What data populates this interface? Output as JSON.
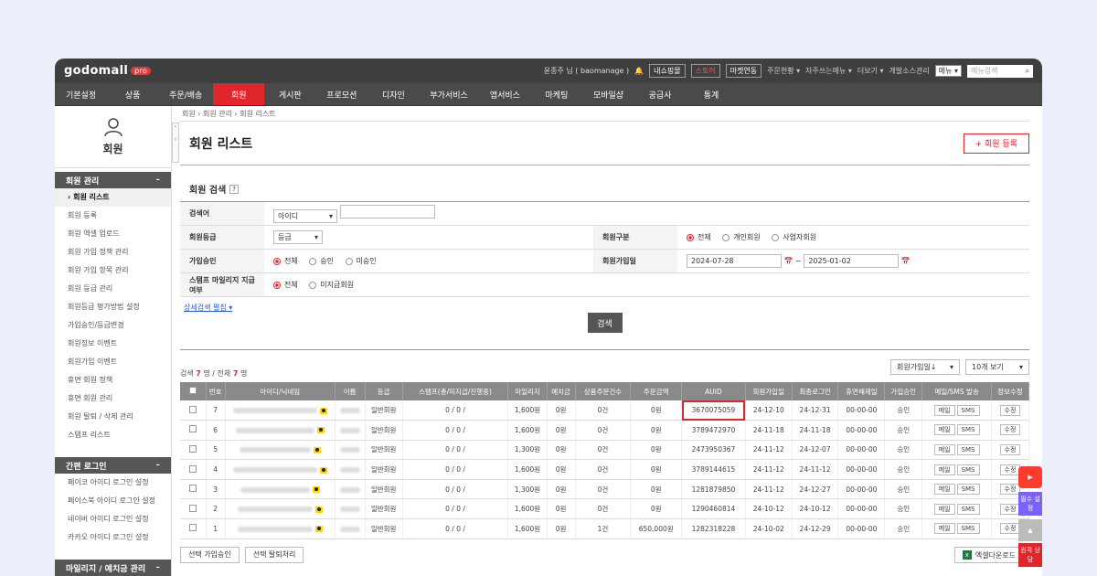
{
  "brand": {
    "logo": "godomall",
    "badge": "pro"
  },
  "topbar": {
    "user": "윤종주 님 ( baomanage )",
    "buttons": [
      "내쇼핑몰",
      "스토어",
      "마켓연동"
    ],
    "links": [
      "주문현황",
      "자주쓰는메뉴",
      "더보기",
      "개발소스관리"
    ],
    "menu_select": "메뉴",
    "search_placeholder": "메뉴검색"
  },
  "nav": [
    "기본설정",
    "상품",
    "주문/배송",
    "회원",
    "게시판",
    "프로모션",
    "디자인",
    "부가서비스",
    "앱서비스",
    "마케팅",
    "모바일샵",
    "공급사",
    "통계"
  ],
  "sidebar": {
    "title": "회원",
    "sections": [
      {
        "label": "회원 관리",
        "items": [
          "› 회원 리스트",
          "회원 등록",
          "회원 엑셀 업로드",
          "회원 가입 정책 관리",
          "회원 가입 항목 관리",
          "회원 등급 관리",
          "회원등급 평가방법 설정",
          "가입승인/등급변경",
          "회원정보 이벤트",
          "회원가입 이벤트",
          "휴면 회원 정책",
          "휴면 회원 관리",
          "회원 탈퇴 / 삭제 관리",
          "스탬프 리스트"
        ]
      },
      {
        "label": "간편 로그인",
        "items": [
          "페이코 아이디 로그인 설정",
          "페이스북 아이디 로그인 설정",
          "네이버 아이디 로그인 설정",
          "카카오 아이디 로그인 설정"
        ]
      },
      {
        "label": "마일리지 / 예치금 관리",
        "items": []
      }
    ]
  },
  "breadcrumb": "회원 › 회원 관리 › 회원 리스트",
  "page": {
    "title": "회원 리스트",
    "register_btn": "+ 회원 등록"
  },
  "search": {
    "title": "회원 검색",
    "help": "?",
    "keyword_label": "검색어",
    "keyword_select": "아이디",
    "grade_label": "회원등급",
    "grade_select": "등급",
    "type_label": "회원구분",
    "type_options": [
      "전체",
      "개인회원",
      "사업자회원"
    ],
    "approve_label": "가입승인",
    "approve_options": [
      "전체",
      "승인",
      "미승인"
    ],
    "joindate_label": "회원가입일",
    "date_from": "2024-07-28",
    "date_to": "2025-01-02",
    "stamp_label": "스탬프 마일리지 지급여부",
    "stamp_options": [
      "전체",
      "미지급회원"
    ],
    "detail_link": "상세검색 펼침",
    "search_btn": "검색"
  },
  "list": {
    "count_prefix": "검색",
    "count": "7",
    "count_mid": "명 / 전체",
    "total": "7",
    "count_suffix": "명",
    "sort": "회원가입일↓",
    "page_size": "10개 보기",
    "headers": [
      "",
      "번호",
      "아이디/닉네임",
      "이름",
      "등급",
      "스탬프(총/미지급/진행중)",
      "마일리지",
      "예치금",
      "상품주문건수",
      "주문금액",
      "AUID",
      "회원가입일",
      "최종로그인",
      "휴면해제일",
      "가입승인",
      "메일/SMS 발송",
      "정보수정"
    ],
    "rows": [
      {
        "no": "7",
        "grade": "일반회원",
        "stamp": "0 / 0 /",
        "mileage": "1,600원",
        "deposit": "0원",
        "orders": "0건",
        "amount": "0원",
        "auid": "3670075059",
        "join": "24-12-10",
        "login": "24-12-31",
        "dormant": "00-00-00",
        "approve": "승인"
      },
      {
        "no": "6",
        "grade": "일반회원",
        "stamp": "0 / 0 /",
        "mileage": "1,600원",
        "deposit": "0원",
        "orders": "0건",
        "amount": "0원",
        "auid": "3789472970",
        "join": "24-11-18",
        "login": "24-11-18",
        "dormant": "00-00-00",
        "approve": "승인"
      },
      {
        "no": "5",
        "grade": "일반회원",
        "stamp": "0 / 0 /",
        "mileage": "1,300원",
        "deposit": "0원",
        "orders": "0건",
        "amount": "0원",
        "auid": "2473950367",
        "join": "24-11-12",
        "login": "24-12-07",
        "dormant": "00-00-00",
        "approve": "승인"
      },
      {
        "no": "4",
        "grade": "일반회원",
        "stamp": "0 / 0 /",
        "mileage": "1,600원",
        "deposit": "0원",
        "orders": "0건",
        "amount": "0원",
        "auid": "3789144615",
        "join": "24-11-12",
        "login": "24-11-12",
        "dormant": "00-00-00",
        "approve": "승인"
      },
      {
        "no": "3",
        "grade": "일반회원",
        "stamp": "0 / 0 /",
        "mileage": "1,300원",
        "deposit": "0원",
        "orders": "0건",
        "amount": "0원",
        "auid": "1281879850",
        "join": "24-11-12",
        "login": "24-12-27",
        "dormant": "00-00-00",
        "approve": "승인"
      },
      {
        "no": "2",
        "grade": "일반회원",
        "stamp": "0 / 0 /",
        "mileage": "1,600원",
        "deposit": "0원",
        "orders": "0건",
        "amount": "0원",
        "auid": "1290460814",
        "join": "24-10-12",
        "login": "24-10-12",
        "dormant": "00-00-00",
        "approve": "승인"
      },
      {
        "no": "1",
        "grade": "일반회원",
        "stamp": "0 / 0 /",
        "mileage": "1,600원",
        "deposit": "0원",
        "orders": "1건",
        "amount": "650,000원",
        "auid": "1282318228",
        "join": "24-10-02",
        "login": "24-12-29",
        "dormant": "00-00-00",
        "approve": "승인"
      }
    ],
    "mail_btn": "메일",
    "sms_btn": "SMS",
    "edit_btn": "수정"
  },
  "footer": {
    "approve_btn": "선택 가입승인",
    "withdraw_btn": "선택 탈퇴처리",
    "excel_btn": "엑셀다운로드"
  },
  "floating": {
    "essential": "필수 설정",
    "consult": "원격 상담"
  },
  "colors": {
    "accent": "#e0262b",
    "header": "#8a8a8a",
    "topbar": "#3f3f3f"
  }
}
